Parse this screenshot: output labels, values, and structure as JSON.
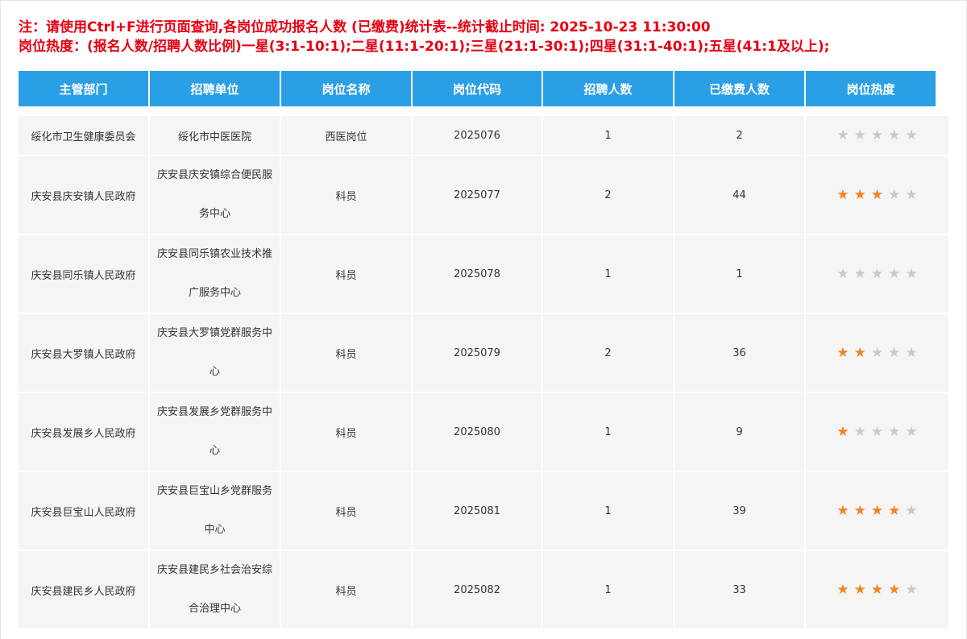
{
  "notice": {
    "line1": "注：请使用Ctrl+F进行页面查询,各岗位成功报名人数 (已缴费)统计表--统计截止时间: 2025-10-23 11:30:00",
    "line2": "岗位热度：(报名人数/招聘人数比例)一星(3:1-10:1);二星(11:1-20:1);三星(21:1-30:1);四星(31:1-40:1);五星(41:1及以上);"
  },
  "table": {
    "headers": [
      "主管部门",
      "招聘单位",
      "岗位名称",
      "岗位代码",
      "招聘人数",
      "已缴费人数",
      "岗位热度"
    ],
    "rows": [
      {
        "dept": "绥化市卫生健康委员会",
        "unit": "绥化市中医医院",
        "position": "西医岗位",
        "code": "2025076",
        "hires": "1",
        "paid": "2",
        "stars": 0
      },
      {
        "dept": "庆安县庆安镇人民政府",
        "unit": "庆安县庆安镇综合便民服务中心",
        "position": "科员",
        "code": "2025077",
        "hires": "2",
        "paid": "44",
        "stars": 3
      },
      {
        "dept": "庆安县同乐镇人民政府",
        "unit": "庆安县同乐镇农业技术推广服务中心",
        "position": "科员",
        "code": "2025078",
        "hires": "1",
        "paid": "1",
        "stars": 0
      },
      {
        "dept": "庆安县大罗镇人民政府",
        "unit": "庆安县大罗镇党群服务中心",
        "position": "科员",
        "code": "2025079",
        "hires": "2",
        "paid": "36",
        "stars": 2
      },
      {
        "dept": "庆安县发展乡人民政府",
        "unit": "庆安县发展乡党群服务中心",
        "position": "科员",
        "code": "2025080",
        "hires": "1",
        "paid": "9",
        "stars": 1
      },
      {
        "dept": "庆安县巨宝山人民政府",
        "unit": "庆安县巨宝山乡党群服务中心",
        "position": "科员",
        "code": "2025081",
        "hires": "1",
        "paid": "39",
        "stars": 4
      },
      {
        "dept": "庆安县建民乡人民政府",
        "unit": "庆安县建民乡社会治安综合治理中心",
        "position": "科员",
        "code": "2025082",
        "hires": "1",
        "paid": "33",
        "stars": 4
      }
    ]
  },
  "icons": {
    "star": "star-icon"
  },
  "colors": {
    "header_bg": "#2b9fe6",
    "notice": "#e60012",
    "star_on": "#f58220",
    "star_off": "#c9c9c9",
    "row_bg": "#f5f5f5"
  }
}
